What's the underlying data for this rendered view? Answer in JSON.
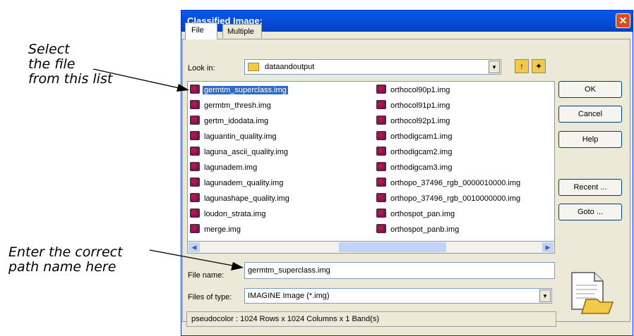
{
  "callouts": {
    "select_file": "Select\nthe file\nfrom this list",
    "enter_path": "Enter the correct\npath name here"
  },
  "dialog": {
    "title": "Classified Image:",
    "close_symbol": "✕",
    "tabs": [
      "File",
      "Multiple"
    ],
    "look_in_label": "Look in:",
    "look_in_value": "dataandoutput",
    "files_column1": [
      "germtm_superclass.img",
      "germtm_thresh.img",
      "gertm_idodata.img",
      "laguantin_quality.img",
      "laguna_ascii_quality.img",
      "lagunadem.img",
      "lagunadem_quality.img",
      "lagunashape_quality.img",
      "loudon_strata.img",
      "merge.img"
    ],
    "files_column2": [
      "orthocol90p1.img",
      "orthocol91p1.img",
      "orthocol92p1.img",
      "orthodigcam1.img",
      "orthodigcam2.img",
      "orthodigcam3.img",
      "orthopo_37496_rgb_0000010000.img",
      "orthopo_37496_rgb_0010000000.img",
      "orthospot_pan.img",
      "orthospot_panb.img"
    ],
    "selected_file": "germtm_superclass.img",
    "file_name_label": "File name:",
    "file_name_value": "germtm_superclass.img",
    "files_of_type_label": "Files of type:",
    "files_of_type_value": "IMAGINE Image (*.img)",
    "status": "pseudocolor : 1024 Rows x 1024 Columns x 1 Band(s)",
    "buttons": {
      "ok": "OK",
      "cancel": "Cancel",
      "help": "Help",
      "recent": "Recent ...",
      "goto": "Goto ..."
    }
  }
}
